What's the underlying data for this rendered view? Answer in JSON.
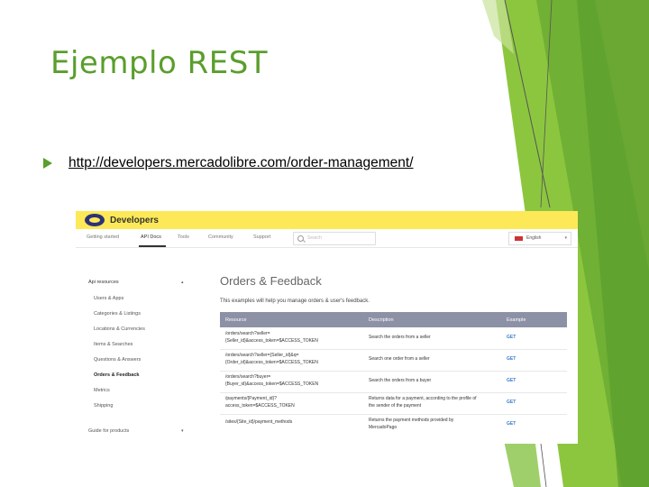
{
  "slide": {
    "title": "Ejemplo REST",
    "bullet_link": "http://developers.mercadolibre.com/order-management/"
  },
  "colors": {
    "green_accent": "#5a9e2c",
    "green_light": "#8cc63f",
    "yellow_header": "#fde957",
    "table_header": "#8d91a6"
  },
  "screenshot": {
    "logo_text": "Developers",
    "nav": [
      "Getting started",
      "API Docs",
      "Tools",
      "Community",
      "Support"
    ],
    "search_placeholder": "Search",
    "language": "English",
    "sidebar": {
      "heading": "Api resources",
      "items": [
        "Users & Apps",
        "Categories & Listings",
        "Locations & Currencies",
        "Items & Searches",
        "Questions & Answers",
        "Orders & Feedback",
        "Metrics",
        "Shipping"
      ],
      "active_item": "Orders & Feedback",
      "guide": "Guide for products"
    },
    "main": {
      "title": "Orders & Feedback",
      "intro": "This examples will help you manage orders & user's feedback.",
      "columns": [
        "Resource",
        "Description",
        "Example"
      ],
      "rows": [
        {
          "resource": [
            "/orders/search?seller=",
            "{Seller_id}&access_token=$ACCESS_TOKEN"
          ],
          "description": [
            "Search the orders from a seller"
          ],
          "example": "GET"
        },
        {
          "resource": [
            "/orders/search?seller={Seller_id}&q=",
            "{Order_id}&access_token=$ACCESS_TOKEN"
          ],
          "description": [
            "Search one order from a seller"
          ],
          "example": "GET"
        },
        {
          "resource": [
            "/orders/search?buyer=",
            "{Buyer_id}&access_token=$ACCESS_TOKEN"
          ],
          "description": [
            "Search the orders from a buyer"
          ],
          "example": "GET"
        },
        {
          "resource": [
            "/payments/{Payment_id}?",
            "access_token=$ACCESS_TOKEN"
          ],
          "description": [
            "Returns data for a payment, according to the profile of",
            "the sender of the payment"
          ],
          "example": "GET"
        },
        {
          "resource": [
            "/sites/{Site_id}/payment_methods"
          ],
          "description": [
            "Returns the payment methods provided by",
            "MercadoPago"
          ],
          "example": "GET"
        }
      ]
    }
  }
}
